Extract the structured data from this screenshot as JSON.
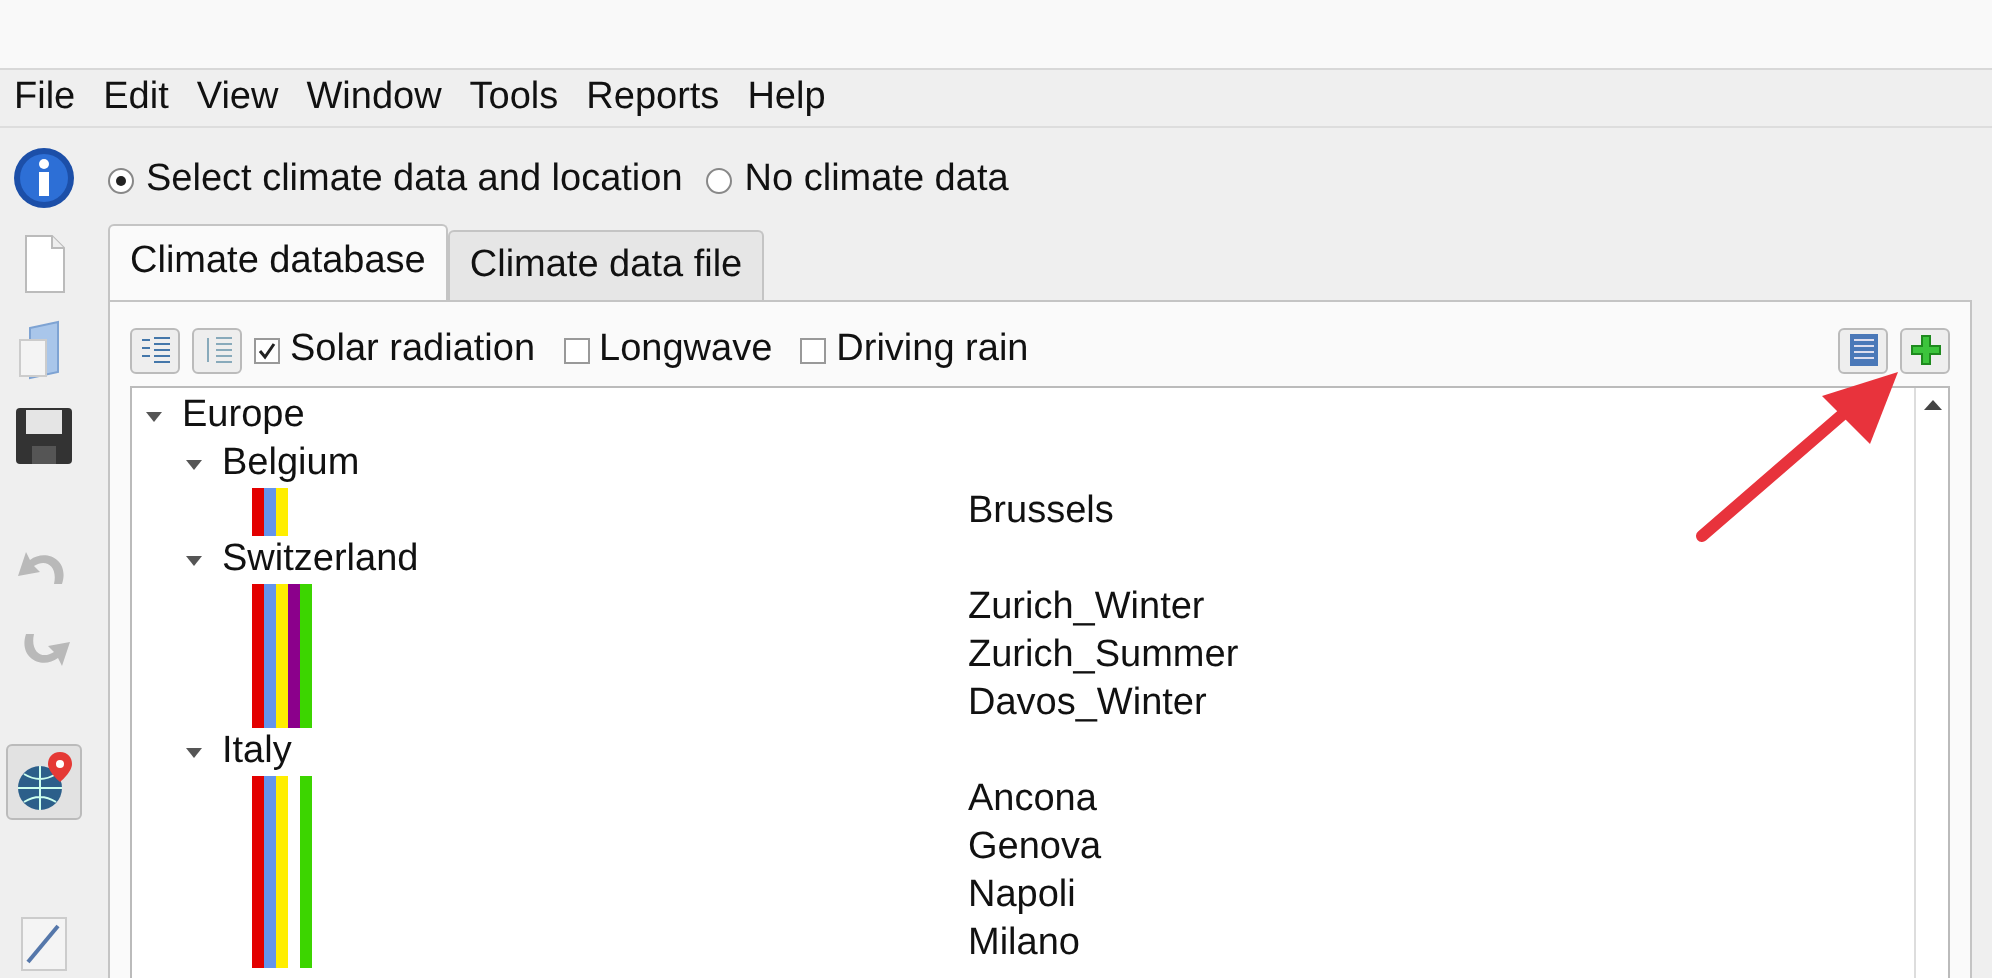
{
  "menu": [
    {
      "label": "File"
    },
    {
      "label": "Edit"
    },
    {
      "label": "View"
    },
    {
      "label": "Window"
    },
    {
      "label": "Tools"
    },
    {
      "label": "Reports"
    },
    {
      "label": "Help"
    }
  ],
  "toolbar": [
    {
      "kind": "info",
      "disabled": false,
      "selected": false
    },
    {
      "kind": "new",
      "disabled": false,
      "selected": false
    },
    {
      "kind": "open",
      "disabled": false,
      "selected": false
    },
    {
      "kind": "save",
      "disabled": false,
      "selected": false
    },
    {
      "kind": "undo",
      "disabled": true,
      "selected": false
    },
    {
      "kind": "redo",
      "disabled": true,
      "selected": false
    },
    {
      "kind": "globe",
      "disabled": false,
      "selected": true
    },
    {
      "kind": "chart",
      "disabled": false,
      "selected": false
    }
  ],
  "source_options": [
    {
      "label": "Select climate data and location",
      "selected": true
    },
    {
      "label": "No climate data",
      "selected": false
    }
  ],
  "tabs": [
    {
      "label": "Climate database",
      "selected": true
    },
    {
      "label": "Climate data file",
      "selected": false
    }
  ],
  "filters": [
    {
      "label": "Solar radiation",
      "checked": true
    },
    {
      "label": "Longwave",
      "checked": false
    },
    {
      "label": "Driving rain",
      "checked": false
    }
  ],
  "tree": [
    {
      "name": "Europe",
      "expanded": true,
      "children": [
        {
          "name": "Belgium",
          "expanded": true,
          "stripes": [
            {
              "color": "#e30000"
            },
            {
              "color": "#6495ed"
            },
            {
              "color": "#ffee00"
            }
          ],
          "locations": [
            "Brussels"
          ]
        },
        {
          "name": "Switzerland",
          "expanded": true,
          "stripes": [
            {
              "color": "#e30000"
            },
            {
              "color": "#6495ed"
            },
            {
              "color": "#ffee00"
            },
            {
              "color": "#8b008b"
            },
            {
              "color": "#3cd500"
            }
          ],
          "locations": [
            "Zurich_Winter",
            "Zurich_Summer",
            "Davos_Winter"
          ]
        },
        {
          "name": "Italy",
          "expanded": true,
          "stripes": [
            {
              "color": "#e30000"
            },
            {
              "color": "#6495ed"
            },
            {
              "color": "#ffee00",
              "gap_after": true
            },
            {
              "color": "#3cd500"
            }
          ],
          "locations": [
            "Ancona",
            "Genova",
            "Napoli",
            "Milano"
          ]
        }
      ]
    }
  ]
}
